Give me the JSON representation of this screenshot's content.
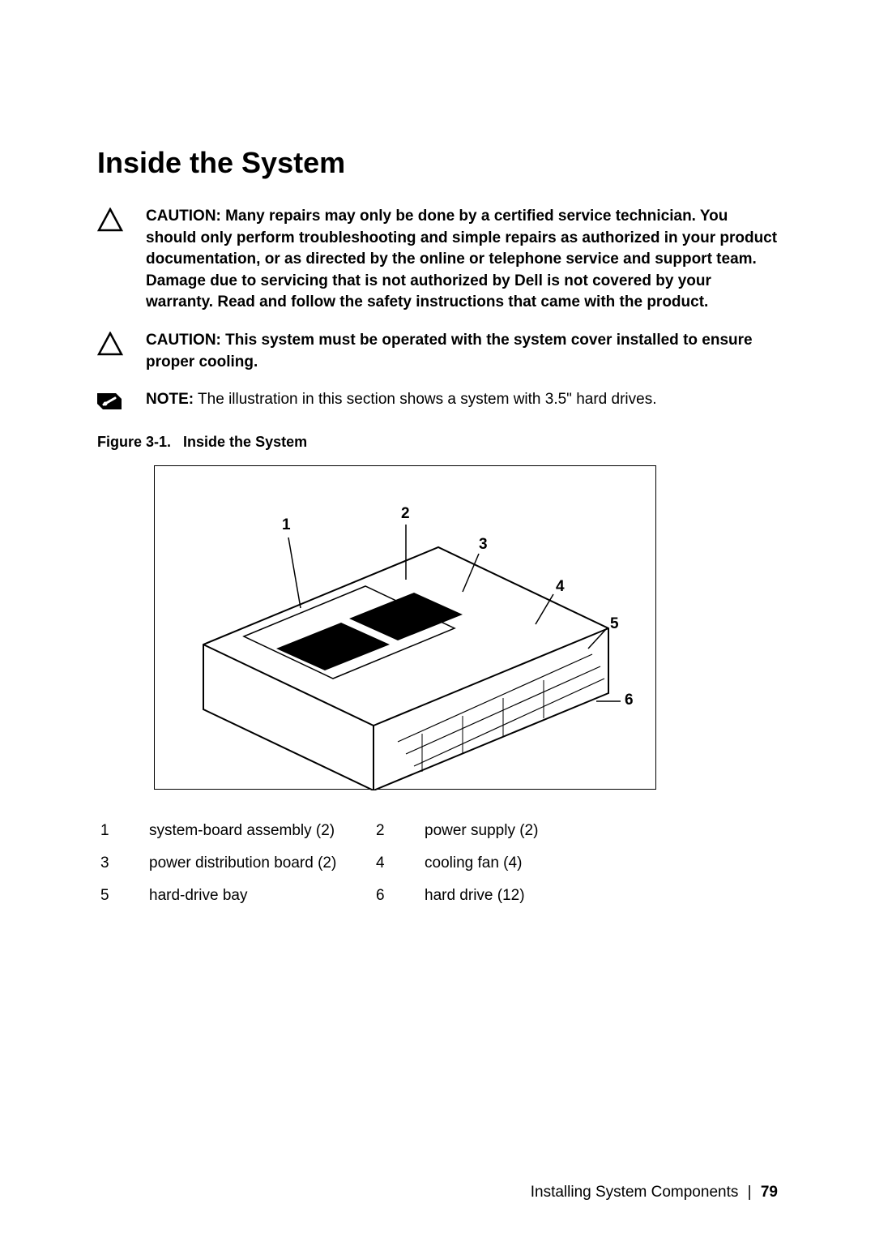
{
  "heading": "Inside the System",
  "callouts": [
    {
      "type": "caution",
      "label": "CAUTION:",
      "text": "Many repairs may only be done by a certified service technician. You should only perform troubleshooting and simple repairs as authorized in your product documentation, or as directed by the online or telephone service and support team. Damage due to servicing that is not authorized by Dell is not covered by your warranty. Read and follow the safety instructions that came with the product."
    },
    {
      "type": "caution",
      "label": "CAUTION:",
      "text": "This system must be operated with the system cover installed to ensure proper cooling."
    },
    {
      "type": "note",
      "label": "NOTE:",
      "text": "The illustration in this section shows a system with 3.5\" hard drives."
    }
  ],
  "figure": {
    "caption_prefix": "Figure 3-1.",
    "caption_title": "Inside the System",
    "diagram_labels": [
      "1",
      "2",
      "3",
      "4",
      "5",
      "6"
    ]
  },
  "legend": [
    {
      "num": "1",
      "text": "system-board assembly (2)"
    },
    {
      "num": "2",
      "text": "power supply (2)"
    },
    {
      "num": "3",
      "text": "power distribution board (2)"
    },
    {
      "num": "4",
      "text": "cooling fan (4)"
    },
    {
      "num": "5",
      "text": "hard-drive bay"
    },
    {
      "num": "6",
      "text": "hard drive (12)"
    }
  ],
  "footer": {
    "section": "Installing System Components",
    "page": "79"
  }
}
